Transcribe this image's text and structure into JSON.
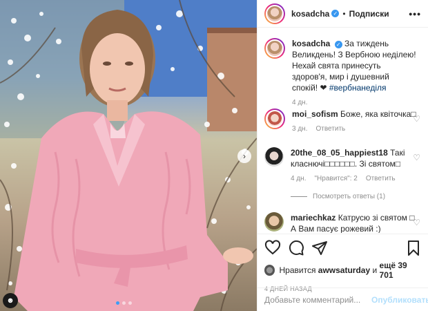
{
  "post": {
    "author": "kosadcha",
    "follow_separator": "•",
    "follow_label": "Подписки",
    "more_label": "•••",
    "caption_text": "За тиждень Великдень! З Вербною неділею! Нехай свята принесуть здоров'я, мир і душевний спокій! ❤",
    "hashtag": "#вербнанеділя",
    "caption_time": "4 дн."
  },
  "comments": [
    {
      "user": "moi_sofism",
      "text": "Боже, яка квіточка□",
      "time": "3 дн.",
      "reply_label": "Ответить"
    },
    {
      "user": "20the_08_05_happiest18",
      "text": "Такі класнючі□□□□□□. Зі святом□",
      "time": "4 дн.",
      "likes_label": "\"Нравится\": 2",
      "reply_label": "Ответить"
    },
    {
      "user": "mariechkaz",
      "text": "Катрусю зі святом □ А Вам пасує рожевий :)"
    }
  ],
  "view_replies_label": "Посмотреть ответы (1)",
  "likes": {
    "prefix": "Нравится",
    "user": "awwsaturday",
    "and_label": "и",
    "count_label": "ещё 39 701"
  },
  "date_label": "4 ДНЕЙ НАЗАД",
  "add_comment": {
    "placeholder": "Добавьте комментарий...",
    "publish_label": "Опубликовать"
  },
  "photo": {
    "next_arrow": "›",
    "user_tag": "☻",
    "dots": 3,
    "active_dot": 0
  },
  "colors": {
    "accent": "#3897f0",
    "publish_disabled": "#b2dffc",
    "sweater": "#f0a8b8"
  }
}
